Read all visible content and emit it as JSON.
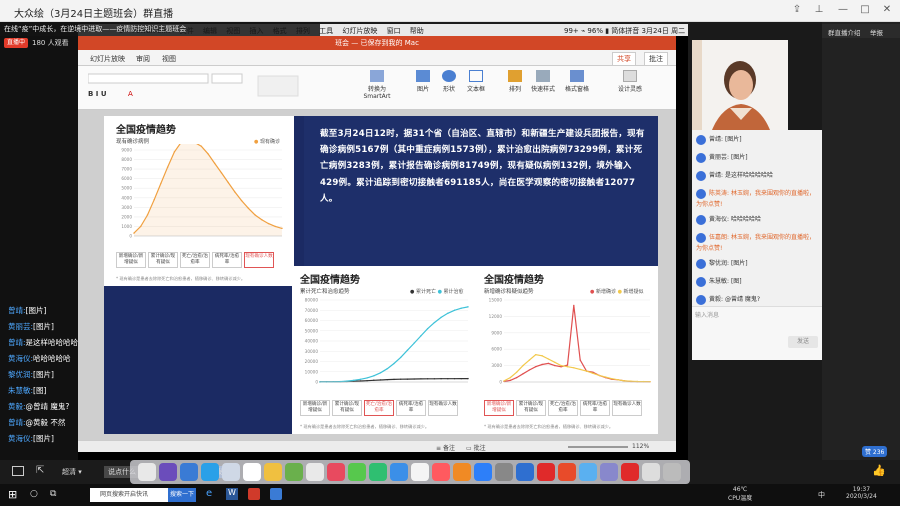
{
  "window": {
    "title": "大众绘（3月24日主题班会）群直播",
    "controls": [
      "share-icon",
      "pin-icon",
      "minimize-icon",
      "maximize-icon",
      "close-icon"
    ]
  },
  "live": {
    "notice": "在线“疫”中成长，在逆境中进取——疫情防控知识主题班会",
    "badge": "直播中",
    "viewers": "180 人观看"
  },
  "left_chat": [
    {
      "name": "曾靖:",
      "msg": "[图片]"
    },
    {
      "name": "黄丽芸:",
      "msg": "[图片]"
    },
    {
      "name": "曾靖:",
      "msg": "是这样哈哈哈哈"
    },
    {
      "name": "黄海仪:",
      "msg": "哈哈哈哈哈"
    },
    {
      "name": "黎优润:",
      "msg": "[图片]"
    },
    {
      "name": "朱慧敏:",
      "msg": "[图]"
    },
    {
      "name": "黄毅:",
      "msg": "@曾靖 魔鬼?"
    },
    {
      "name": "曾靖:",
      "msg": "@黄毅 不然"
    },
    {
      "name": "黄海仪:",
      "msg": "[图片]"
    }
  ],
  "mac": {
    "menu": [
      "PowerPoint",
      "文件",
      "编辑",
      "视图",
      "插入",
      "格式",
      "排列",
      "工具",
      "幻灯片放映",
      "窗口",
      "帮助"
    ],
    "status": "99+ ⌁ 96% ▮ 简体拼音 3月24日 周二 19:37"
  },
  "ppt": {
    "title": "班会 — 已保存到我的 Mac",
    "tabs": [
      "幻灯片放映",
      "审阅",
      "视图"
    ],
    "share": "共享",
    "comment": "批注",
    "ribbon": [
      "转换为SmartArt",
      "图片",
      "形状",
      "文本框",
      "排列",
      "快速样式",
      "格式窗格",
      "设计灵感"
    ],
    "status": {
      "notes": "备注",
      "comments": "批注",
      "zoom": "112%"
    }
  },
  "slide": {
    "statement": "截至3月24日12时，据31个省（自治区、直辖市）和新疆生产建设兵团报告，现有确诊病例5167例（其中重症病例1573例），累计治愈出院病例73299例，累计死亡病例3283例，累计报告确诊病例81749例，现有疑似病例132例，境外输入429例。累计追踪到密切接触者691185人，尚在医学观察的密切接触者12077人。",
    "panel1": {
      "title": "全国疫情趋势",
      "subtitle": "现有确诊病例",
      "legend": "现有确诊",
      "tabs": [
        "新增确诊/新增疑似",
        "累计确诊/现有疑似",
        "死亡/治愈/治愈率",
        "病死率/治愈率",
        "现有确诊人数"
      ],
      "active": 4,
      "note": "* 现有确诊是患者去除除死亡和治愈患者，随移确诊、移转确诊减少。"
    },
    "panel2": {
      "title": "全国疫情趋势",
      "subtitle": "累计死亡和治愈趋势",
      "legend": [
        "累计死亡",
        "累计治愈"
      ],
      "tabs": [
        "新增确诊/新增疑似",
        "累计确诊/现有疑似",
        "死亡/治愈/治愈率",
        "病死率/治愈率",
        "现有确诊人数"
      ],
      "active": 2,
      "note": "* 现有确诊是患者去除除死亡和治愈患者，随移确诊、移转确诊减少。"
    },
    "panel3": {
      "title": "全国疫情趋势",
      "subtitle": "新增确诊和疑似趋势",
      "legend": [
        "新增确诊",
        "新增疑似"
      ],
      "tabs": [
        "新增确诊/新增疑似",
        "累计确诊/现有疑似",
        "死亡/治愈/治愈率",
        "病死率/治愈率",
        "现有确诊人数"
      ],
      "active": 0,
      "note": "* 现有确诊是患者去除除死亡和治愈患者，随移确诊、移转确诊减少。"
    }
  },
  "chart_data": [
    {
      "type": "area",
      "title": "全国疫情趋势",
      "subtitle": "现有确诊病例",
      "series": [
        {
          "name": "现有确诊",
          "values": [
            300,
            1000,
            2200,
            3800,
            5500,
            7200,
            8800,
            9800,
            10000,
            9800,
            9400,
            8600,
            7600,
            6600,
            5600,
            4600,
            3700,
            2900,
            2200,
            1700,
            1300,
            1000,
            800
          ]
        }
      ],
      "ylim": [
        0,
        9000
      ],
      "yticks": [
        0,
        1000,
        2000,
        3000,
        4000,
        5000,
        6000,
        7000,
        8000,
        9000
      ],
      "color": "#f0a040"
    },
    {
      "type": "line",
      "title": "全国疫情趋势",
      "subtitle": "累计死亡和治愈趋势",
      "series": [
        {
          "name": "累计死亡",
          "values": [
            50,
            100,
            200,
            300,
            500,
            700,
            1000,
            1300,
            1700,
            2000,
            2300,
            2500,
            2700,
            2800,
            2900,
            3000,
            3100,
            3150,
            3200,
            3230,
            3250,
            3270,
            3283
          ]
        },
        {
          "name": "累计治愈",
          "values": [
            50,
            100,
            200,
            400,
            900,
            1600,
            2600,
            4000,
            6000,
            9000,
            13000,
            18000,
            24000,
            31000,
            38000,
            45000,
            52000,
            58000,
            63000,
            67000,
            70000,
            72000,
            73299
          ]
        }
      ],
      "ylim": [
        0,
        80000
      ],
      "yticks": [
        0,
        10000,
        20000,
        30000,
        40000,
        50000,
        60000,
        70000,
        80000
      ],
      "colors": [
        "#333333",
        "#3ec2d8"
      ]
    },
    {
      "type": "line",
      "title": "全国疫情趋势",
      "subtitle": "新增确诊和疑似趋势",
      "series": [
        {
          "name": "新增确诊",
          "values": [
            100,
            300,
            800,
            1500,
            2200,
            2800,
            3200,
            3400,
            3000,
            2800,
            3100,
            14000,
            4000,
            2000,
            1800,
            1200,
            800,
            500,
            400,
            200,
            100,
            80,
            60,
            40
          ]
        },
        {
          "name": "新增疑似",
          "values": [
            200,
            800,
            1800,
            3000,
            4000,
            5000,
            4800,
            4200,
            3600,
            3000,
            2800,
            2600,
            2300,
            2000,
            1600,
            1200,
            900,
            600,
            400,
            200,
            150,
            100,
            80,
            60
          ]
        }
      ],
      "ylim": [
        0,
        15000
      ],
      "yticks": [
        0,
        3000,
        6000,
        9000,
        12000,
        15000
      ],
      "colors": [
        "#e05050",
        "#f2c94c"
      ]
    }
  ],
  "right_chat": {
    "items": [
      {
        "name": "曾靖:",
        "msg": "[图片]"
      },
      {
        "name": "黄丽芸:",
        "msg": "[图片]"
      },
      {
        "name": "曾靖:",
        "msg": "是这样哈哈哈哈哈"
      },
      {
        "name": "陈英涛:",
        "msg": "林玉婉，我来围观你的直播啦，为你点赞!",
        "hl": true
      },
      {
        "name": "黄海仪:",
        "msg": "哈哈哈哈哈"
      },
      {
        "name": "伍嘉朗:",
        "msg": "林玉婉，我来围观你的直播啦，为你点赞!",
        "hl": true
      },
      {
        "name": "黎优润:",
        "msg": "[图片]"
      },
      {
        "name": "朱慧敏:",
        "msg": "[图]"
      },
      {
        "name": "黄毅:",
        "msg": "@曾靖 魔鬼?"
      }
    ],
    "input_placeholder": "输入消息",
    "send": "发送"
  },
  "right_top": [
    "群直播介绍",
    "举报"
  ],
  "bottom": {
    "quality": "超清",
    "share": "发送",
    "tools": [
      "说点什么"
    ],
    "likes": "赞 236"
  },
  "taskbar": {
    "search": "网页搜索开启快讯",
    "searchbtn": "搜索一下",
    "cpu": "46℃",
    "cpu_label": "CPU温度",
    "time": "19:37",
    "date": "2020/3/24",
    "lang": "中"
  }
}
